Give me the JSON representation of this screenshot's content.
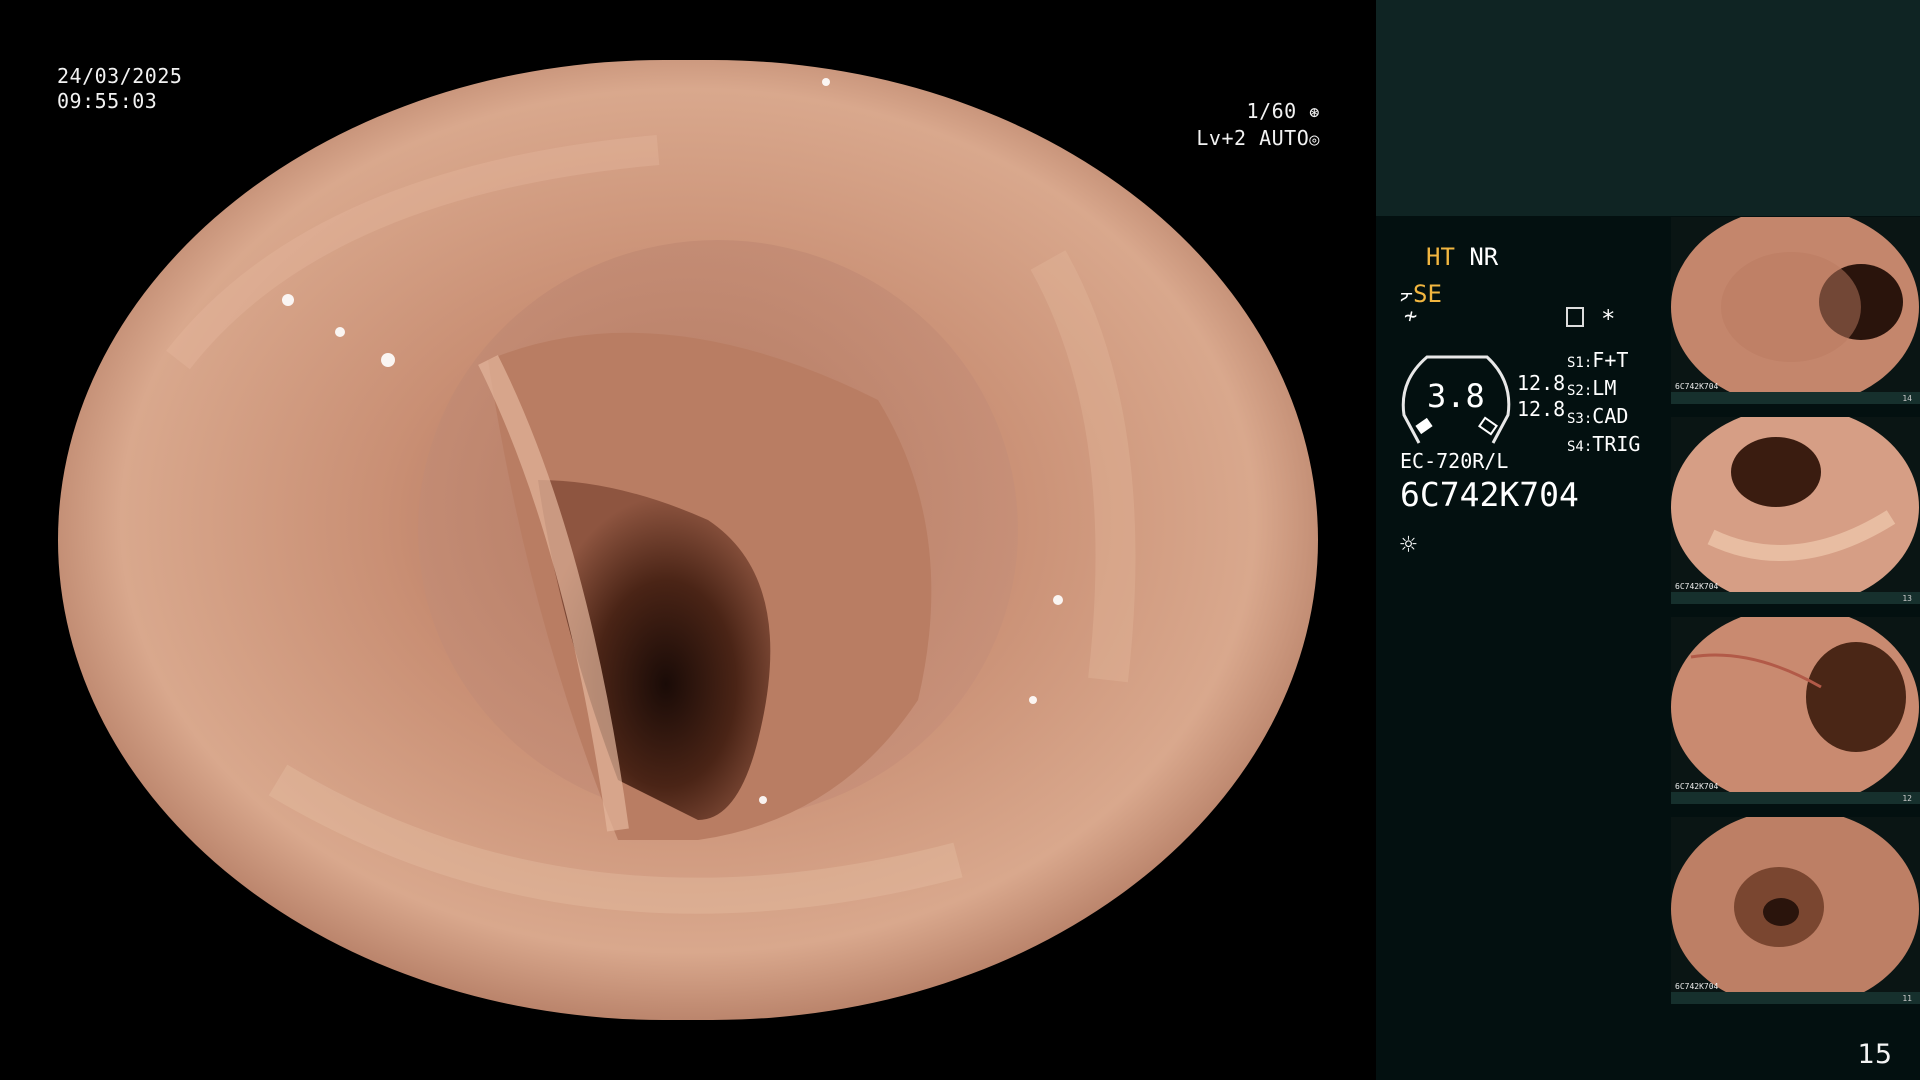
{
  "overlay": {
    "date": "24/03/2025",
    "time": "09:55:03",
    "shutter": "1/60",
    "level": "Lv+2",
    "iris_mode": "AUTO"
  },
  "panel": {
    "ht": "HT",
    "nr": "NR",
    "se": "SE",
    "zoom": "3.8",
    "value_1": "12.8",
    "value_2": "12.8",
    "switches": [
      {
        "key": "S1:",
        "value": "F+T"
      },
      {
        "key": "S2:",
        "value": "LM"
      },
      {
        "key": "S3:",
        "value": "CAD"
      },
      {
        "key": "S4:",
        "value": "TRIG"
      }
    ],
    "scope_model": "EC-720R/L",
    "scope_serial": "6C742K704",
    "accent_color": "#f2b640",
    "thumbnail_counters": [
      "14",
      "13",
      "12",
      "11"
    ],
    "thumbnail_label": "6C742K704"
  },
  "page_number": "15"
}
